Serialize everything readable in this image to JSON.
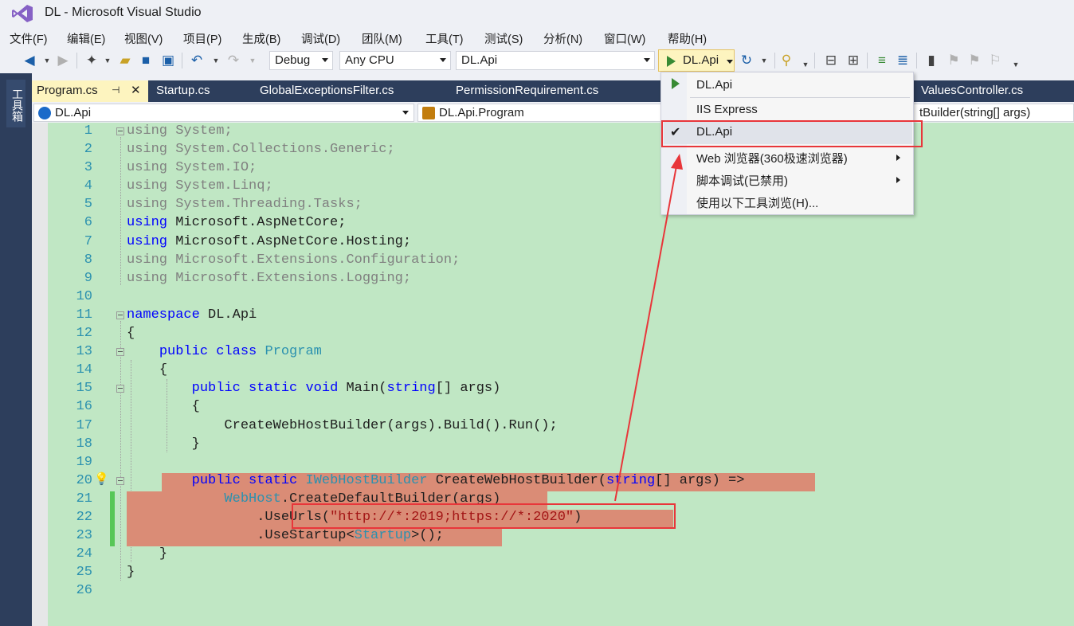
{
  "window": {
    "title": "DL - Microsoft Visual Studio"
  },
  "menu": [
    "文件(F)",
    "编辑(E)",
    "视图(V)",
    "项目(P)",
    "生成(B)",
    "调试(D)",
    "团队(M)",
    "工具(T)",
    "测试(S)",
    "分析(N)",
    "窗口(W)",
    "帮助(H)"
  ],
  "toolbar": {
    "config": "Debug",
    "platform": "Any CPU",
    "startup_project": "DL.Api",
    "run_label": "DL.Api"
  },
  "toolbox": {
    "label": "工具箱"
  },
  "tabs": [
    "Program.cs",
    "Startup.cs",
    "GlobalExceptionsFilter.cs",
    "PermissionRequirement.cs",
    "ValuesController.cs"
  ],
  "navbar": {
    "project": "DL.Api",
    "type": "DL.Api.Program",
    "member": "tBuilder(string[] args)"
  },
  "run_menu": {
    "items": [
      "DL.Api",
      "IIS Express",
      "DL.Api",
      "Web 浏览器(360极速浏览器)",
      "脚本调试(已禁用)",
      "使用以下工具浏览(H)..."
    ],
    "checked_index": 2
  },
  "code": {
    "line_numbers": [
      "1",
      "2",
      "3",
      "4",
      "5",
      "6",
      "7",
      "8",
      "9",
      "10",
      "11",
      "12",
      "13",
      "14",
      "15",
      "16",
      "17",
      "18",
      "19",
      "20",
      "21",
      "22",
      "23",
      "24",
      "25",
      "26"
    ],
    "usings": [
      "System",
      "System.Collections.Generic",
      "System.IO",
      "System.Linq",
      "System.Threading.Tasks",
      "Microsoft.AspNetCore",
      "Microsoft.AspNetCore.Hosting",
      "Microsoft.Extensions.Configuration",
      "Microsoft.Extensions.Logging"
    ],
    "kw_using": "using",
    "kw_namespace": "namespace",
    "namespace_name": "DL.Api",
    "open_brace": "{",
    "close_brace": "}",
    "kw_public": "public",
    "kw_class": "class",
    "kw_static": "static",
    "kw_void": "void",
    "kw_string": "string",
    "class_name": "Program",
    "main_name": "Main(",
    "main_args": "[] args)",
    "main_body": "CreateWebHostBuilder(args).Build().Run();",
    "iface": "IWebHostBuilder",
    "method_name": "CreateWebHostBuilder(",
    "method_args": "[] args) =>",
    "webhost": "WebHost",
    "create_default": ".CreateDefaultBuilder(args)",
    "use_urls_pre": ".UseUrls(",
    "use_urls_str": "\"http://*:2019;https://*:2020\"",
    "use_urls_post": ")",
    "use_startup_pre": ".UseStartup<",
    "startup": "Startup",
    "use_startup_post": ">();"
  },
  "colors": {
    "keyword": "#0000ff",
    "type": "#2b91af",
    "string": "#a31515",
    "editor_bg": "#c0e7c4",
    "annotation": "#e8363a"
  }
}
